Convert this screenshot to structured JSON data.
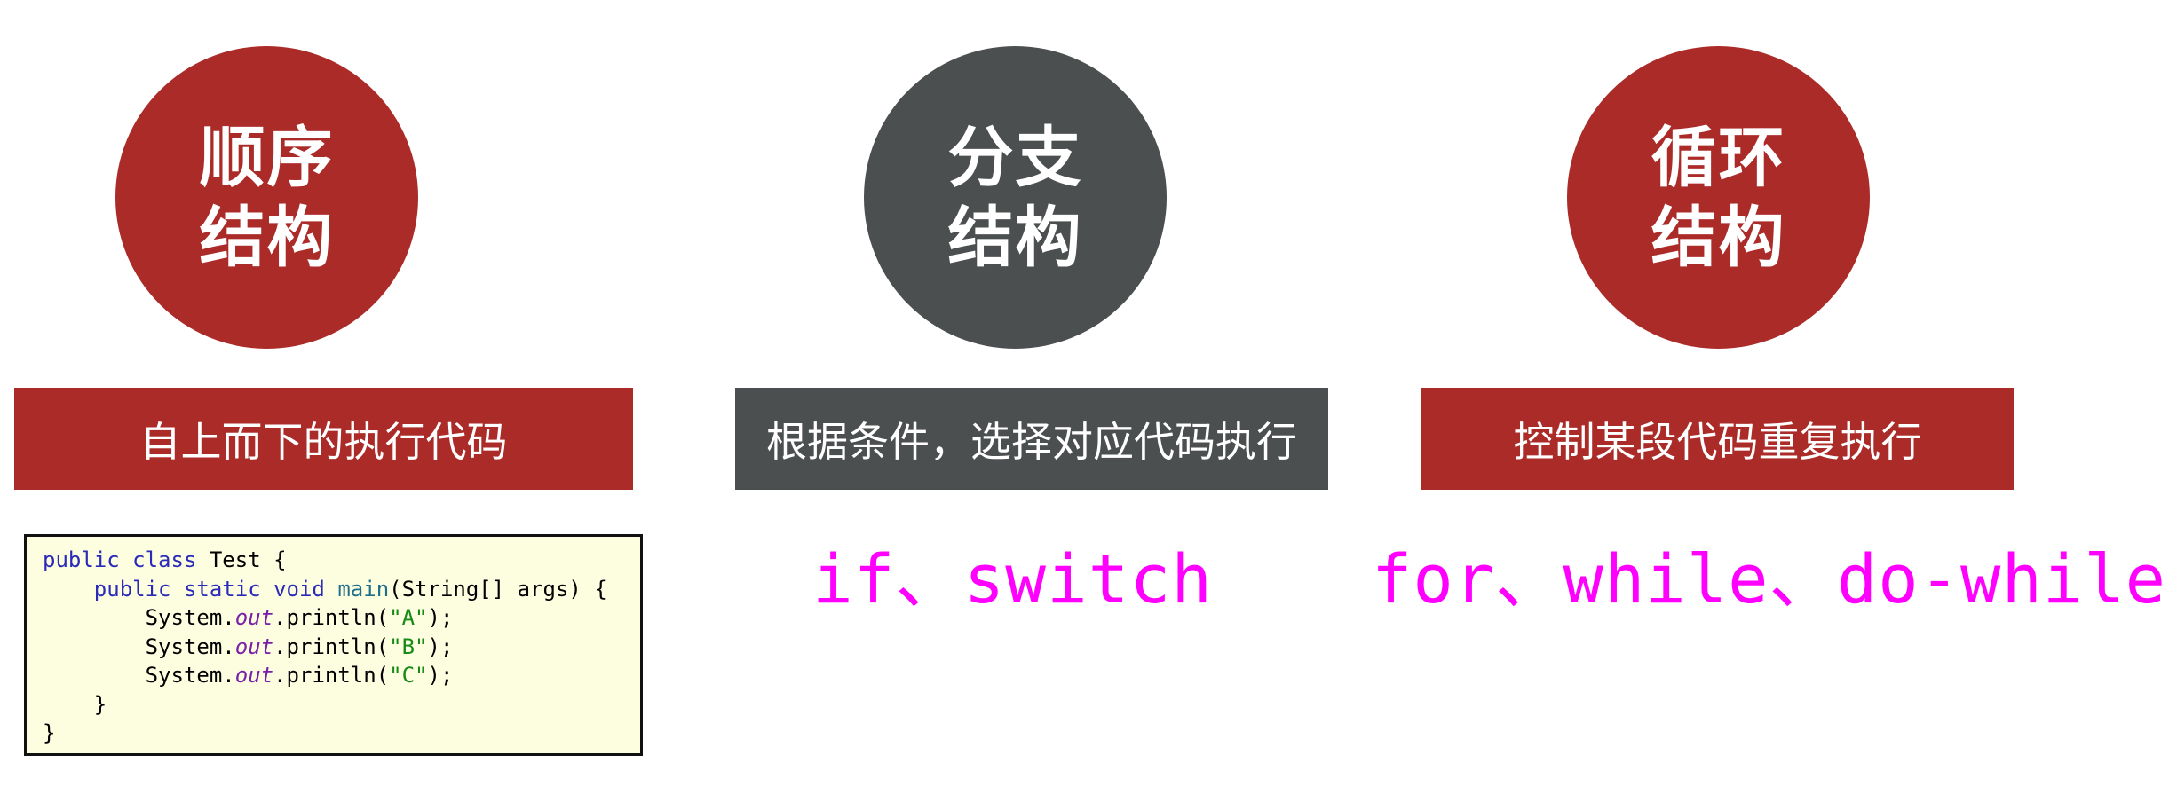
{
  "colors": {
    "red": "#ab2b28",
    "gray": "#4b4f4f",
    "magenta": "#ff00ff",
    "code_bg": "#fdfde0"
  },
  "structures": [
    {
      "title_line1": "顺序",
      "title_line2": "结构",
      "description": "自上而下的执行代码",
      "color": "red"
    },
    {
      "title_line1": "分支",
      "title_line2": "结构",
      "description": "根据条件，选择对应代码执行",
      "color": "gray"
    },
    {
      "title_line1": "循环",
      "title_line2": "结构",
      "description": "控制某段代码重复执行",
      "color": "red"
    }
  ],
  "code": {
    "l1_kw": "public class",
    "l1_rest": " Test {",
    "l2_indent": "    ",
    "l2_kw": "public static void",
    "l2_sp": " ",
    "l2_fn": "main",
    "l2_rest": "(String[] args) {",
    "l3_pre": "        System.",
    "l3_field": "out",
    "l3_mid": ".println(",
    "l3_str": "\"A\"",
    "l3_end": ");",
    "l4_pre": "        System.",
    "l4_field": "out",
    "l4_mid": ".println(",
    "l4_str": "\"B\"",
    "l4_end": ");",
    "l5_pre": "        System.",
    "l5_field": "out",
    "l5_mid": ".println(",
    "l5_str": "\"C\"",
    "l5_end": ");",
    "l6": "    }",
    "l7": "}"
  },
  "branch_keywords": "if、switch",
  "loop_keywords": "for、while、do-while"
}
